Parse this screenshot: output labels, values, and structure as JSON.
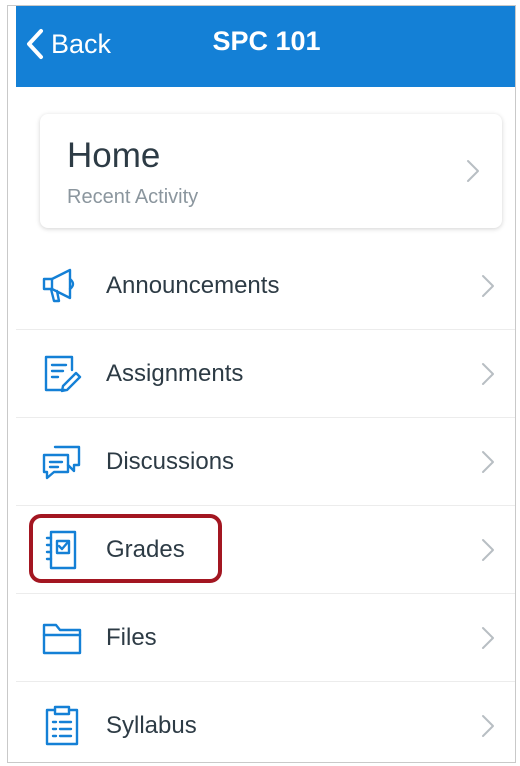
{
  "header": {
    "back_label": "Back",
    "title": "SPC 101",
    "bar_color": "#1480d6"
  },
  "home": {
    "title": "Home",
    "subtitle": "Recent Activity"
  },
  "nav": {
    "items": [
      {
        "label": "Announcements",
        "icon": "megaphone-icon"
      },
      {
        "label": "Assignments",
        "icon": "assignment-icon"
      },
      {
        "label": "Discussions",
        "icon": "discussion-icon"
      },
      {
        "label": "Grades",
        "icon": "gradebook-icon",
        "highlighted": true
      },
      {
        "label": "Files",
        "icon": "folder-icon"
      },
      {
        "label": "Syllabus",
        "icon": "syllabus-icon"
      }
    ],
    "icon_color": "#1480d6",
    "highlight_color": "#a31621"
  }
}
